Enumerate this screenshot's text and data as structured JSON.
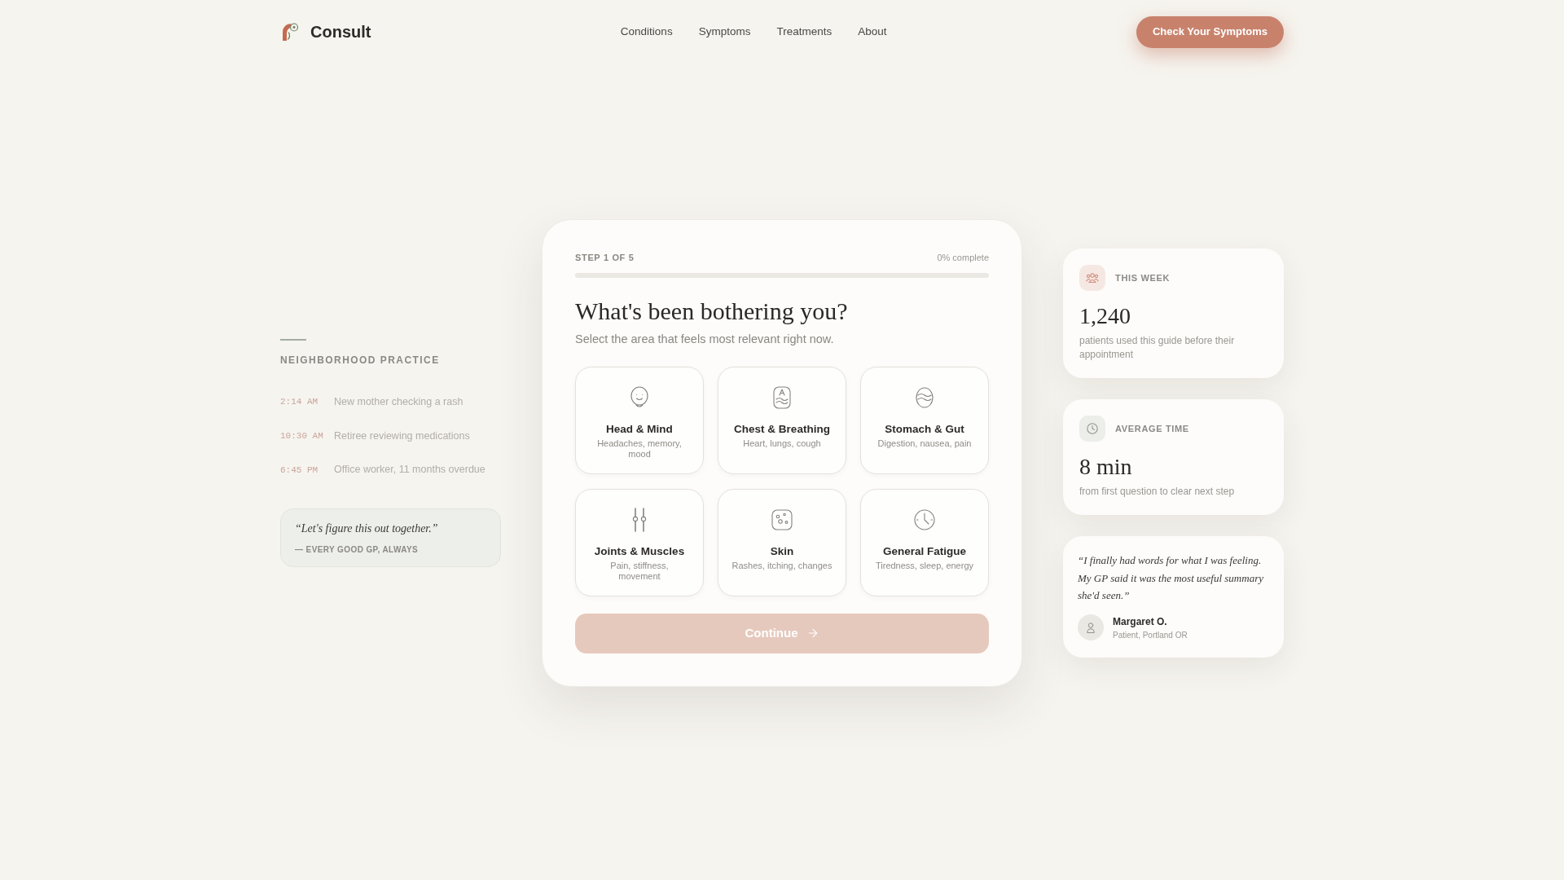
{
  "header": {
    "brand": "Consult",
    "nav": [
      {
        "label": "Conditions"
      },
      {
        "label": "Symptoms"
      },
      {
        "label": "Treatments"
      },
      {
        "label": "About"
      }
    ],
    "cta": "Check Your Symptoms"
  },
  "practice": {
    "title": "NEIGHBORHOOD PRACTICE",
    "visits": [
      {
        "time": "2:14 AM",
        "text": "New mother checking a rash"
      },
      {
        "time": "10:30 AM",
        "text": "Retiree reviewing medications"
      },
      {
        "time": "6:45 PM",
        "text": "Office worker, 11 months overdue"
      }
    ],
    "quote": {
      "text": "“Let's figure this out together.”",
      "attribution": "— EVERY GOOD GP, ALWAYS"
    }
  },
  "questionnaire": {
    "step": "STEP 1 OF 5",
    "progress_text": "0% complete",
    "title": "What's been bothering you?",
    "subtitle": "Select the area that feels most relevant right now.",
    "areas": [
      {
        "title": "Head & Mind",
        "description": "Headaches, memory, mood",
        "selected": false
      },
      {
        "title": "Chest & Breathing",
        "description": "Heart, lungs, cough",
        "selected": false
      },
      {
        "title": "Stomach & Gut",
        "description": "Digestion, nausea, pain",
        "selected": false
      },
      {
        "title": "Joints & Muscles",
        "description": "Pain, stiffness, movement",
        "selected": false
      },
      {
        "title": "Skin",
        "description": "Rashes, itching, changes",
        "selected": false
      },
      {
        "title": "General Fatigue",
        "description": "Tiredness, sleep, energy",
        "selected": false
      }
    ],
    "continue": {
      "label": "Continue",
      "disabled": true
    }
  },
  "stats": [
    {
      "label": "THIS WEEK",
      "value": "1,240",
      "description": "patients used this guide before their appointment"
    },
    {
      "label": "AVERAGE TIME",
      "value": "8 min",
      "description": "from first question to clear next step"
    }
  ],
  "testimonial": {
    "quote": "“I finally had words for what I was feeling. My GP said it was the most useful summary she'd seen.”",
    "name": "Margaret O.",
    "role": "Patient, Portland OR"
  }
}
